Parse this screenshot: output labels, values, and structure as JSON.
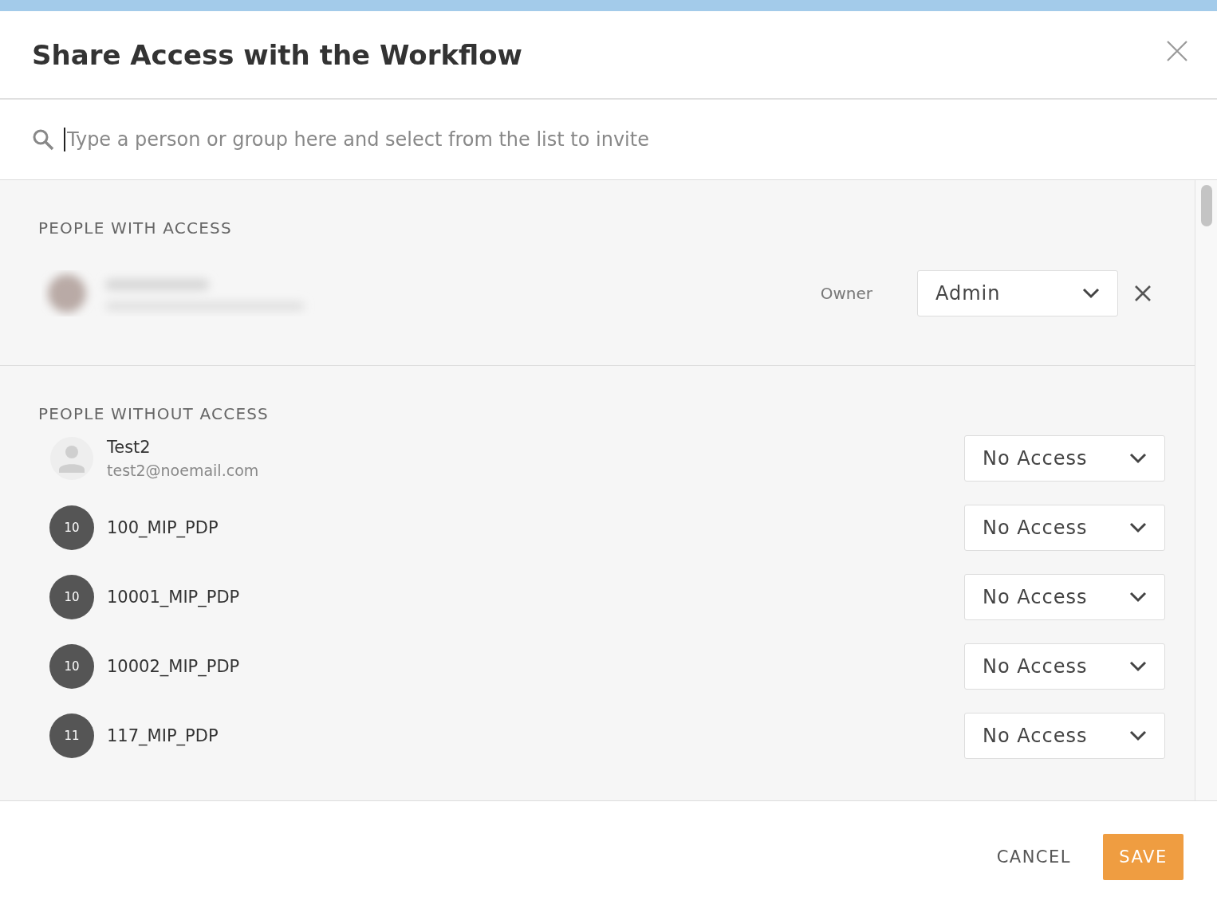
{
  "dialog": {
    "title": "Share Access with the Workflow"
  },
  "search": {
    "placeholder": "Type a person or group here and select from the list to invite"
  },
  "people_with_access": {
    "heading": "PEOPLE WITH ACCESS",
    "rows": [
      {
        "role_label": "Owner",
        "access": "Admin"
      }
    ]
  },
  "people_without_access": {
    "heading": "PEOPLE WITHOUT ACCESS",
    "rows": [
      {
        "kind": "user",
        "name": "Test2",
        "email": "test2@noemail.com",
        "access": "No Access"
      },
      {
        "kind": "group",
        "initials": "10",
        "name": "100_MIP_PDP",
        "access": "No Access"
      },
      {
        "kind": "group",
        "initials": "10",
        "name": "10001_MIP_PDP",
        "access": "No Access"
      },
      {
        "kind": "group",
        "initials": "10",
        "name": "10002_MIP_PDP",
        "access": "No Access"
      },
      {
        "kind": "group",
        "initials": "11",
        "name": "117_MIP_PDP",
        "access": "No Access"
      }
    ]
  },
  "buttons": {
    "cancel": "CANCEL",
    "save": "SAVE"
  }
}
